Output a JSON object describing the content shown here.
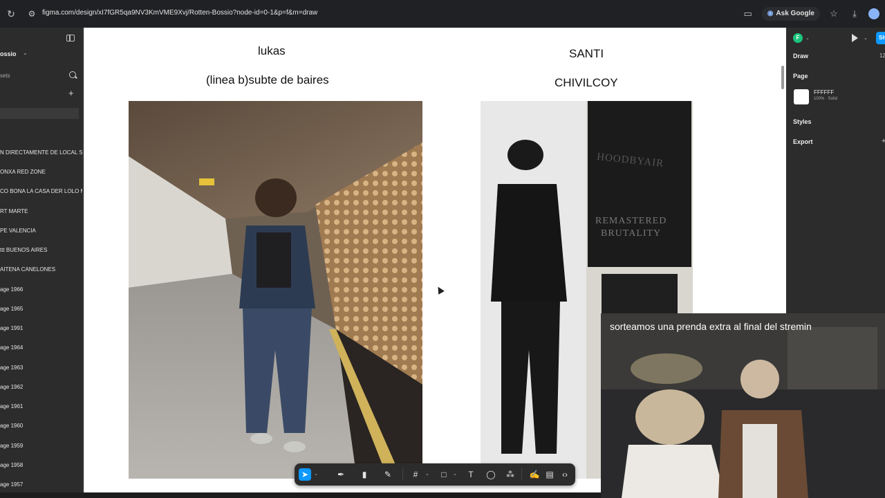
{
  "browser": {
    "url": "figma.com/design/xI7fGR5qa9NV3KmVME9Xvj/Rotten-Bossio?node-id=0-1&p=f&m=draw",
    "ask_google_label": "Ask Google"
  },
  "left_panel": {
    "file_name": "ossio",
    "assets_label": "sets",
    "pages": [
      "N DIRECTAMENTE DE LOCAL SU",
      "ONXA RED ZONE",
      "CO BONA LA CASA DER LOLO M",
      "RT MARTE",
      "PE VALENCIA",
      "ttt BUENOS AIRES",
      "AITENA CANELONES",
      "age 1966",
      "age 1965",
      "age 1991",
      "age 1964",
      "age 1963",
      "age 1962",
      "age 1961",
      "age 1960",
      "age 1959",
      "age 1958",
      "age 1957"
    ]
  },
  "canvas": {
    "left_card": {
      "name": "lukas",
      "location": "(linea b)subte de baires"
    },
    "right_card": {
      "name": "SANTI",
      "location": "CHIVILCOY"
    },
    "shirt_print_line1": "HOODBYAIR",
    "shirt_print_line2": "REMASTERED",
    "shirt_print_line3": "BRUTALITY"
  },
  "right_panel": {
    "avatar_initial": "F",
    "share_label": "Sh",
    "mode_label": "Draw",
    "zoom": "12",
    "page_section": "Page",
    "page_color_hex": "FFFFFF",
    "page_fill": "100% · Solid",
    "styles_label": "Styles",
    "export_label": "Export"
  },
  "toolbar": {
    "tools": [
      "move-tool",
      "pen-tool",
      "marker-tool",
      "pencil-tool",
      "frame-tool",
      "shape-tool",
      "text-tool",
      "comment-tool",
      "components-tool",
      "draw-mode",
      "dev-tool",
      "code-tool"
    ]
  },
  "webcam": {
    "caption": "sorteamos una prenda extra al final del stremin"
  },
  "colors": {
    "figma_panel": "#2c2c2c",
    "accent": "#0d99ff",
    "canvas": "#ffffff"
  }
}
